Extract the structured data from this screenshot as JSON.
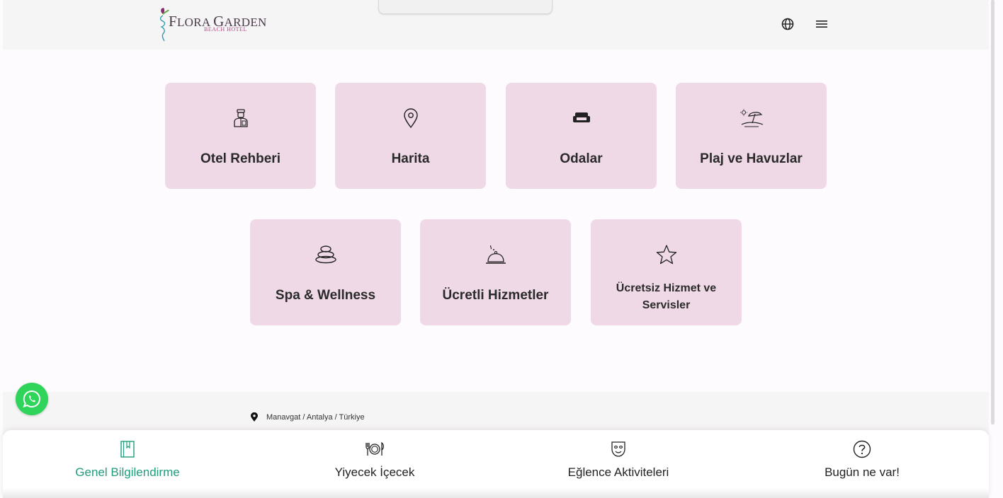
{
  "header": {
    "logo": {
      "brand_first": "F",
      "brand_rest1": "LORA ",
      "brand_cap2": "G",
      "brand_rest2": "ARDEN",
      "sub": "BEACH HOTEL"
    },
    "icons": {
      "language": "globe-icon",
      "menu": "hamburger-icon"
    }
  },
  "cards": [
    {
      "label": "Otel Rehberi",
      "icon": "bellboy-icon"
    },
    {
      "label": "Harita",
      "icon": "map-pin-icon"
    },
    {
      "label": "Odalar",
      "icon": "sofa-icon"
    },
    {
      "label": "Plaj ve Havuzlar",
      "icon": "beach-umbrella-icon"
    },
    {
      "label": "Spa & Wellness",
      "icon": "spa-stones-icon"
    },
    {
      "label": "Ücretli Hizmetler",
      "icon": "cloche-icon"
    },
    {
      "label": "Ücretsiz Hizmet ve Servisler",
      "icon": "star-icon"
    }
  ],
  "footer": {
    "location": "Manavgat / Antalya / Türkiye"
  },
  "bottom_nav": [
    {
      "label": "Genel Bilgilendirme",
      "icon": "book-icon",
      "active": true
    },
    {
      "label": "Yiyecek İçecek",
      "icon": "fork-plate-knife-icon",
      "active": false
    },
    {
      "label": "Eğlence Aktiviteleri",
      "icon": "mask-icon",
      "active": false
    },
    {
      "label": "Bugün ne var!",
      "icon": "question-circle-icon",
      "active": false
    }
  ],
  "colors": {
    "card_bg": "#f0d9e6",
    "active_nav": "#1f9d7c",
    "whatsapp": "#2fd45a",
    "brand_pink": "#b14a8a"
  }
}
